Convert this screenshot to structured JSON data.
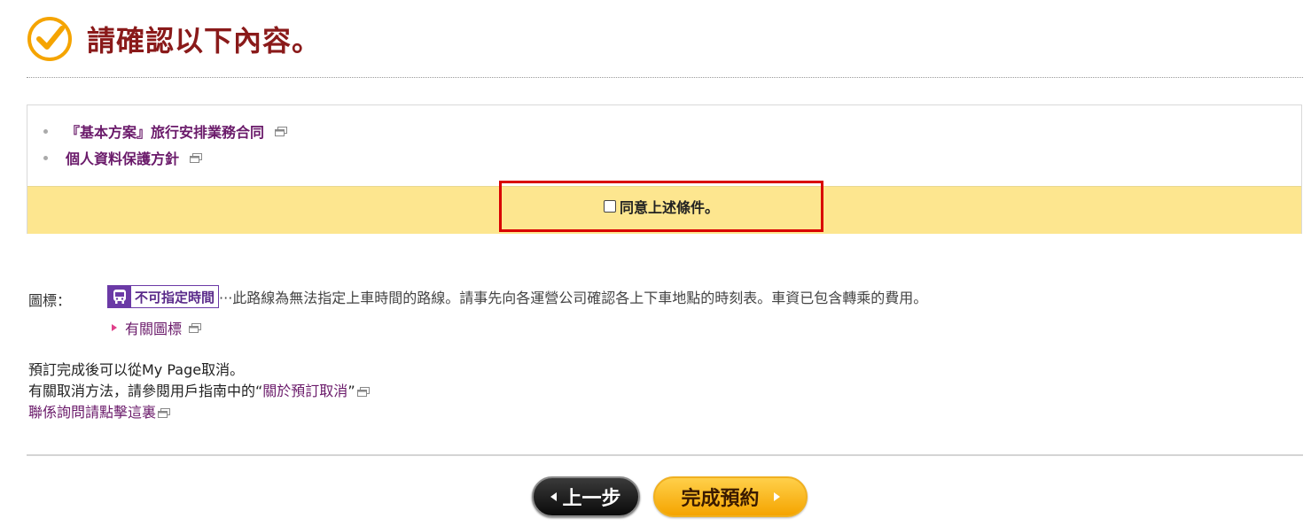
{
  "header": {
    "title": "請確認以下內容。"
  },
  "terms": {
    "items": [
      {
        "label": "『基本方案』旅行安排業務合同"
      },
      {
        "label": "個人資料保護方針"
      }
    ],
    "agree_label": "同意上述條件。",
    "agree_checked": false
  },
  "legend": {
    "label": "圖標：",
    "badge_text": "不可指定時間",
    "description": "···此路線為無法指定上車時間的路線。請事先向各運營公司確認各上下車地點的時刻表。車資已包含轉乘的費用。",
    "link_label": "有關圖標"
  },
  "cancel": {
    "line1": "預訂完成後可以從My Page取消。",
    "line2_prefix": "有關取消方法，請參閱用戶指南中的“",
    "line2_link": "關於預訂取消",
    "line2_suffix": "”",
    "contact_link": "聯係詢問請點擊這裏"
  },
  "buttons": {
    "back_label": "上一步",
    "next_label": "完成預約"
  },
  "colors": {
    "title": "#8a1a1a",
    "link": "#6a1a6a",
    "agree_band": "#fde68f",
    "highlight_frame": "#d90000",
    "badge": "#6b3aa6",
    "next_button": "#f5a400"
  },
  "icons": {
    "header": "check-circle-icon",
    "external": "popup-window-icon",
    "badge": "bus-icon"
  }
}
